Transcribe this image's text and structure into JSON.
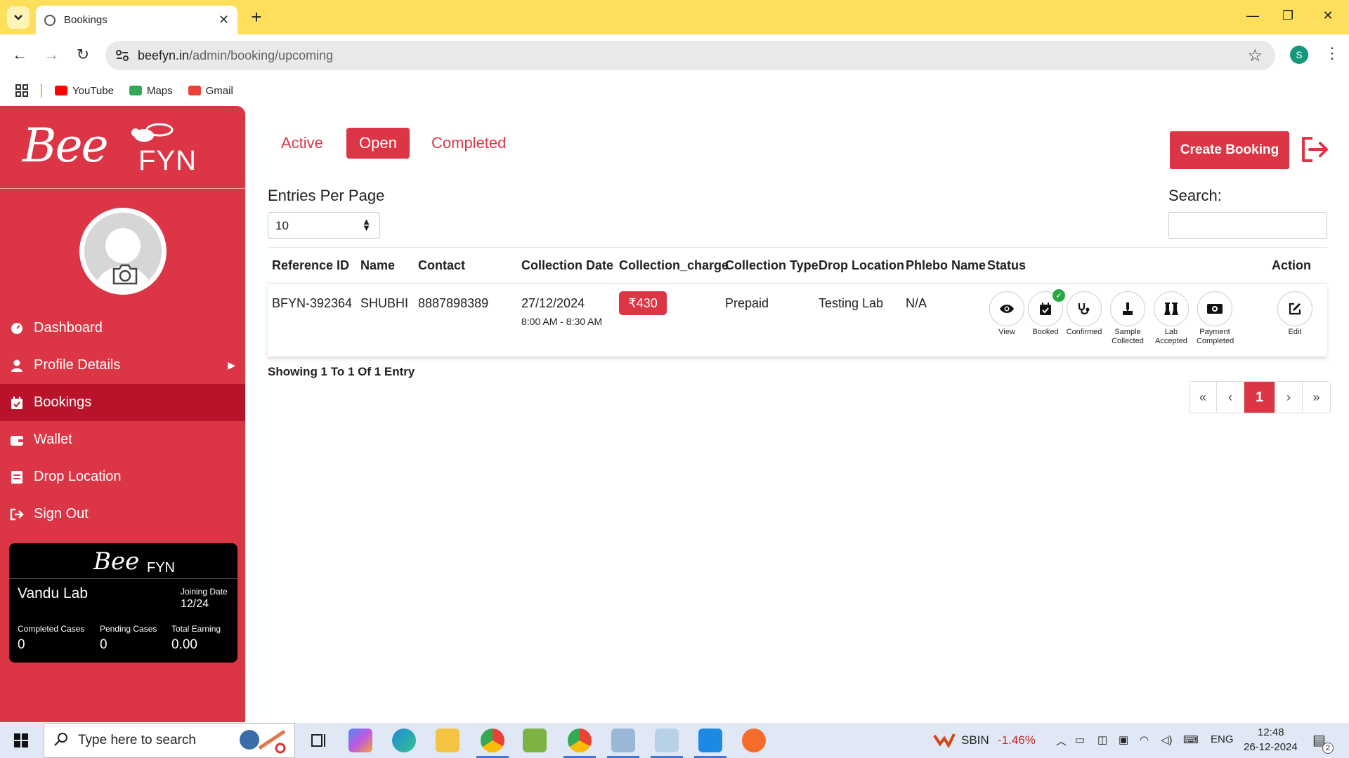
{
  "browser": {
    "tab_title": "Bookings",
    "url_domain": "beefyn.in",
    "url_path": "/admin/booking/upcoming",
    "profile_initial": "S",
    "bookmarks": [
      {
        "label": "YouTube",
        "color": "#ff0000"
      },
      {
        "label": "Maps",
        "color": "#34a853"
      },
      {
        "label": "Gmail",
        "color": "#ea4335"
      }
    ]
  },
  "brand": {
    "logo_script": "Bee",
    "logo_text": "FYN",
    "accent": "#dc3545",
    "active_menu_bg": "#b8132b"
  },
  "sidebar": {
    "menu": [
      {
        "label": "Dashboard",
        "icon": "dashboard-icon"
      },
      {
        "label": "Profile Details",
        "icon": "user-icon"
      },
      {
        "label": "Bookings",
        "icon": "calendar-icon"
      },
      {
        "label": "Wallet",
        "icon": "wallet-icon"
      },
      {
        "label": "Drop Location",
        "icon": "location-icon"
      },
      {
        "label": "Sign Out",
        "icon": "sign-out-icon"
      }
    ],
    "card": {
      "name": "Vandu Lab",
      "joining_label": "Joining Date",
      "joining_value": "12/24",
      "stats": [
        {
          "label": "Completed Cases",
          "value": "0"
        },
        {
          "label": "Pending Cases",
          "value": "0"
        },
        {
          "label": "Total Earning",
          "value": "0.00"
        }
      ]
    }
  },
  "filter_tabs": [
    "Active",
    "Open",
    "Completed"
  ],
  "active_tab": "Open",
  "create_button": "Create Booking",
  "entries_label": "Entries Per Page",
  "entries_value": "10",
  "search_label": "Search:",
  "table": {
    "headers": [
      "Reference ID",
      "Name",
      "Contact",
      "Collection Date",
      "Collection_charge",
      "Collection Type",
      "Drop Location",
      "Phlebo Name",
      "Status",
      "Action"
    ],
    "rows": [
      {
        "reference_id": "BFYN-392364",
        "name": "SHUBHI",
        "contact": "8887898389",
        "collection_date": "27/12/2024",
        "collection_time": "8:00 AM - 8:30 AM",
        "charge": "₹430",
        "collection_type": "Prepaid",
        "drop_location": "Testing Lab",
        "phlebo_name": "N/A",
        "status_steps": [
          {
            "label": "View",
            "icon": "eye-icon"
          },
          {
            "label": "Booked",
            "icon": "calendar-check-icon",
            "done": true
          },
          {
            "label": "Confirmed",
            "icon": "stethoscope-icon"
          },
          {
            "label": "Sample Collected",
            "icon": "sample-icon"
          },
          {
            "label": "Lab Accepted",
            "icon": "flask-icon"
          },
          {
            "label": "Payment Completed",
            "icon": "money-icon"
          }
        ],
        "action": {
          "label": "Edit",
          "icon": "edit-icon"
        }
      }
    ]
  },
  "showing_text": "Showing 1 To 1 Of 1 Entry",
  "pagination": {
    "first": "«",
    "prev": "‹",
    "current": "1",
    "next": "›",
    "last": "»"
  },
  "taskbar": {
    "search_placeholder": "Type here to search",
    "stock_name": "SBIN",
    "stock_change": "-1.46%",
    "lang": "ENG",
    "time": "12:48",
    "date": "26-12-2024",
    "notification_count": "2"
  }
}
